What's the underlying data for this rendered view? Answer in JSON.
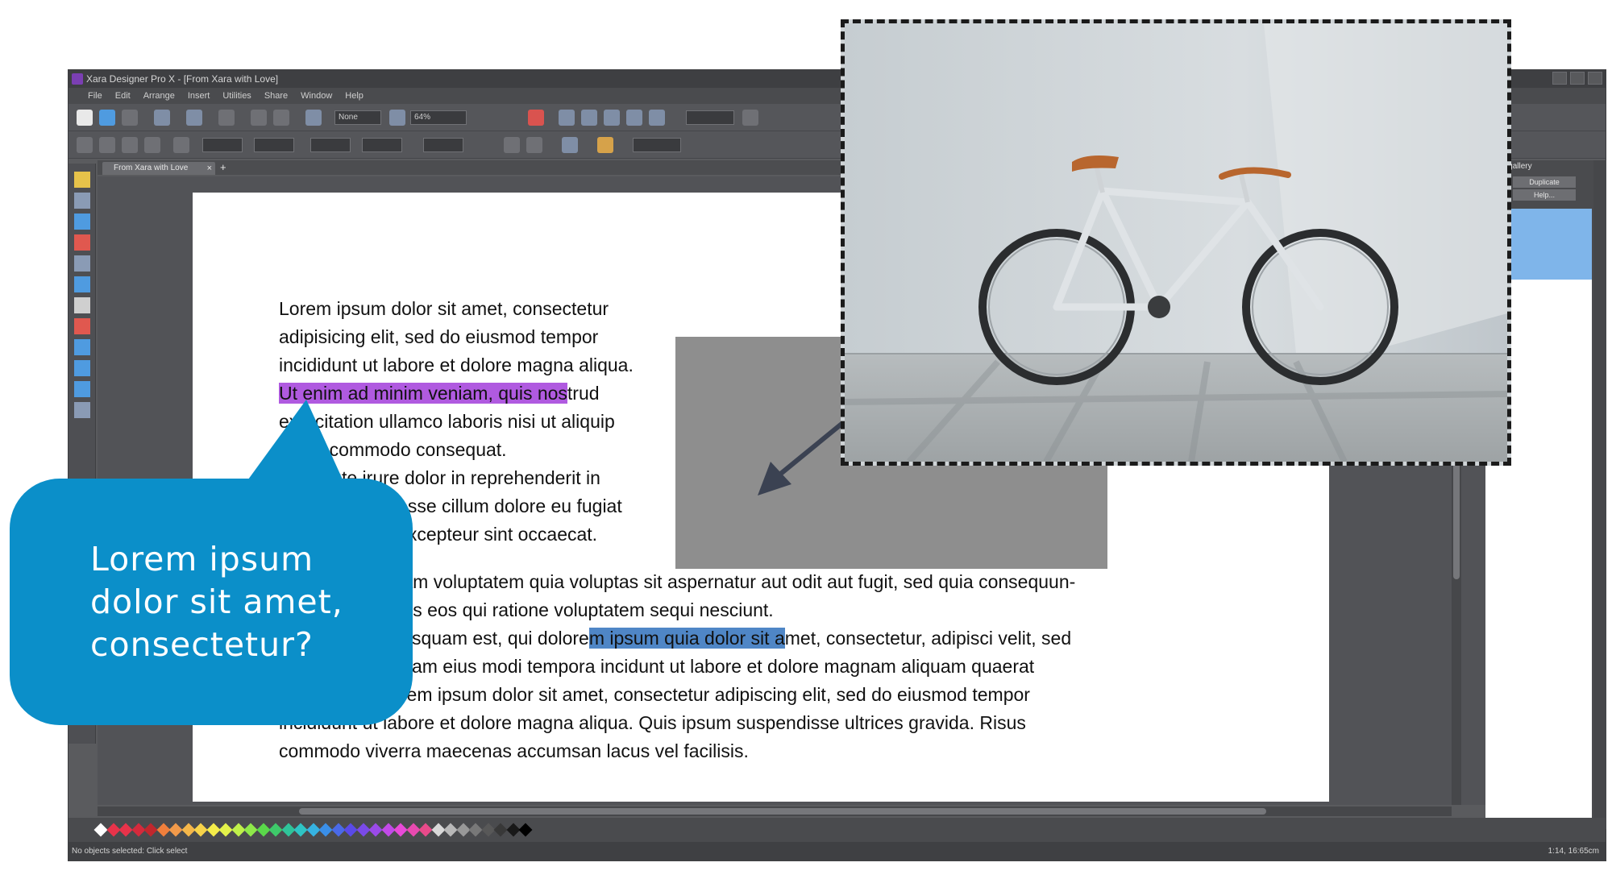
{
  "window": {
    "title": "Xara Designer Pro X - [From Xara with Love]"
  },
  "menu": [
    "File",
    "Edit",
    "Arrange",
    "Insert",
    "Utilities",
    "Share",
    "Window",
    "Help"
  ],
  "toolbar": {
    "style_field": "None",
    "zoom_field": "64%"
  },
  "document_tab": {
    "label": "From Xara with Love",
    "close": "×",
    "add": "+"
  },
  "right_panel": {
    "title": "Page gallery",
    "duplicate_label": "Duplicate",
    "help_label": "Help..."
  },
  "status": {
    "left": "No objects selected: Click select",
    "right": "1:14, 16:65cm"
  },
  "document": {
    "para1": {
      "line1": "Lorem ipsum dolor sit amet, consectetur",
      "line2": "adipisicing elit, sed do eiusmod tempor",
      "line3": "incididunt ut labore et dolore magna aliqua.",
      "line4_highlight": "Ut enim ad minim veniam, quis nos",
      "line4_rest": "trud",
      "line5": "exercitation ullamco laboris nisi ut aliquip",
      "line6": "ex ea commodo consequat.",
      "line7": "Duis aute irure dolor in reprehenderit in",
      "line8": "voluptate velit esse cillum dolore eu fugiat",
      "line9": "nulla pariatur. Excepteur sint occaecat."
    },
    "para2": {
      "line1": "Nemo enim ipsam voluptatem quia voluptas sit aspernatur aut odit aut fugit, sed quia consequun-",
      "line2": "tur magni dolores eos qui ratione voluptatem sequi nesciunt.",
      "line3_pre": "Neque porro quisquam est, qui dolore",
      "line3_highlight": "m ipsum quia dolor sit a",
      "line3_post": "met, consectetur, adipisci velit, sed",
      "line4": "quia non numquam eius modi tempora incidunt ut labore et dolore magnam aliquam quaerat",
      "line5": "voluptatem. Lorem ipsum dolor sit amet, consectetur adipiscing elit, sed do eiusmod tempor",
      "line6": "incididunt ut labore et dolore magna aliqua. Quis ipsum suspendisse ultrices gravida. Risus",
      "line7": "commodo viverra maecenas accumsan lacus vel facilisis."
    }
  },
  "bubble": {
    "line1": "Lorem ipsum",
    "line2": "dolor sit amet,",
    "line3": "consectetur?"
  },
  "colors": {
    "bubble": "#0b8fc9",
    "highlight_purple": "#b05ae0",
    "highlight_blue": "#4f86c6",
    "gray_box": "#8e8e8e",
    "arrow": "#3b4252"
  },
  "palette": [
    "#ffffff",
    "#e8334a",
    "#e8334a",
    "#d42a3c",
    "#c1272d",
    "#f07f3c",
    "#f29a4a",
    "#f5b74a",
    "#f7d34a",
    "#f4ec4a",
    "#e3f24a",
    "#bff04a",
    "#8fe84a",
    "#5ad84a",
    "#3ec96a",
    "#2fc49a",
    "#2fc4c4",
    "#36b3e2",
    "#3a8fe8",
    "#4a6ae8",
    "#5a4ae8",
    "#7a4ae8",
    "#9a4ae8",
    "#c24ae8",
    "#e84ad8",
    "#e84ab0",
    "#e84a8a",
    "#d8d8d8",
    "#b8b8b8",
    "#989898",
    "#787878",
    "#585858",
    "#383838",
    "#181818",
    "#000000"
  ]
}
